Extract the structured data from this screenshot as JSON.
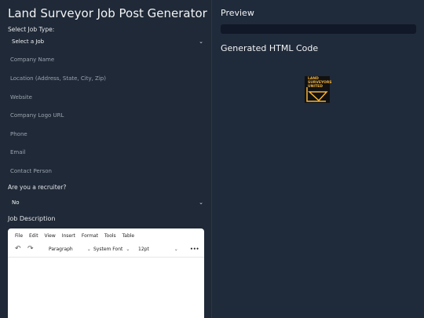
{
  "form": {
    "title": "Land Surveyor Job Post Generator",
    "job_type_label": "Select Job Type:",
    "job_type_selected": "Select a Job",
    "fields": [
      "Company Name",
      "Location (Address, State, City, Zip)",
      "Website",
      "Company Logo URL",
      "Phone",
      "Email",
      "Contact Person"
    ],
    "recruiter_label": "Are you a recruiter?",
    "recruiter_selected": "No",
    "job_description_label": "Job Description"
  },
  "editor": {
    "menu": [
      "File",
      "Edit",
      "View",
      "Insert",
      "Format",
      "Tools",
      "Table"
    ],
    "block_format": "Paragraph",
    "font_family": "System Font",
    "font_size": "12pt",
    "more": "•••",
    "undo_icon": "undo-icon",
    "redo_icon": "redo-icon"
  },
  "preview": {
    "title": "Preview",
    "code_title": "Generated HTML Code",
    "logo_lines": [
      "LAND",
      "SURVEYORS",
      "UNITED"
    ],
    "logo_color": "#f4b33a"
  }
}
